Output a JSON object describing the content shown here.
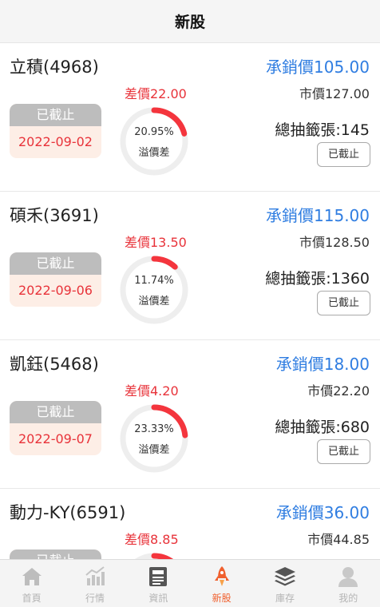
{
  "header": {
    "title": "新股"
  },
  "stocks": [
    {
      "name": "立積(4968)",
      "underwrite": "承銷價105.00",
      "market": "市價127.00",
      "diff": "差價22.00",
      "status": "已截止",
      "date": "2022-09-02",
      "premium_pct": "20.95%",
      "premium_fraction": 0.2095,
      "premium_label": "溢價差",
      "lottery": "總抽籤張:145",
      "button": "已截止"
    },
    {
      "name": "碩禾(3691)",
      "underwrite": "承銷價115.00",
      "market": "市價128.50",
      "diff": "差價13.50",
      "status": "已截止",
      "date": "2022-09-06",
      "premium_pct": "11.74%",
      "premium_fraction": 0.1174,
      "premium_label": "溢價差",
      "lottery": "總抽籤張:1360",
      "button": "已截止"
    },
    {
      "name": "凱鈺(5468)",
      "underwrite": "承銷價18.00",
      "market": "市價22.20",
      "diff": "差價4.20",
      "status": "已截止",
      "date": "2022-09-07",
      "premium_pct": "23.33%",
      "premium_fraction": 0.2333,
      "premium_label": "溢價差",
      "lottery": "總抽籤張:680",
      "button": "已截止"
    },
    {
      "name": "動力-KY(6591)",
      "underwrite": "承銷價36.00",
      "market": "市價44.85",
      "diff": "差價8.85",
      "status": "已截止",
      "date": "",
      "premium_pct": "",
      "premium_fraction": 0.2,
      "premium_label": "",
      "lottery": "",
      "button": ""
    }
  ],
  "tabs": [
    {
      "label": "首頁",
      "icon": "home-icon"
    },
    {
      "label": "行情",
      "icon": "chart-icon"
    },
    {
      "label": "資訊",
      "icon": "news-icon"
    },
    {
      "label": "新股",
      "icon": "rocket-icon",
      "active": true
    },
    {
      "label": "庫存",
      "icon": "layers-icon"
    },
    {
      "label": "我的",
      "icon": "user-icon"
    }
  ],
  "colors": {
    "accent": "#f0602e",
    "blue": "#2f7de1",
    "red": "#e8333a",
    "ring_track": "#eeeeee",
    "ring_fill": "#f4353d"
  }
}
